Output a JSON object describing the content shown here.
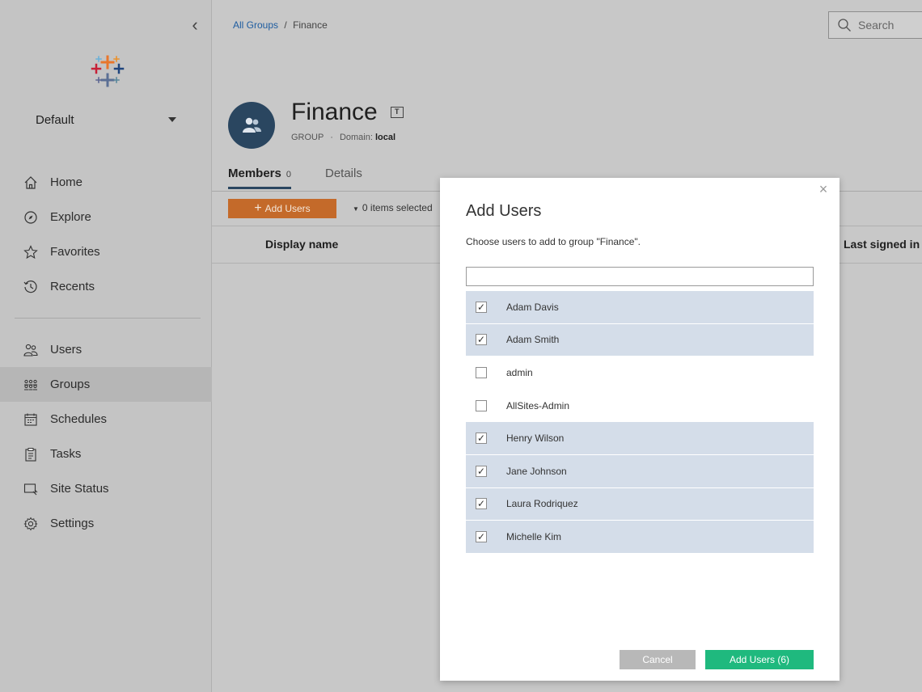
{
  "sidebar": {
    "site": "Default",
    "items": [
      {
        "label": "Home",
        "icon": "home-icon"
      },
      {
        "label": "Explore",
        "icon": "explore-icon"
      },
      {
        "label": "Favorites",
        "icon": "star-icon"
      },
      {
        "label": "Recents",
        "icon": "clock-icon"
      },
      {
        "label": "Users",
        "icon": "users-icon"
      },
      {
        "label": "Groups",
        "icon": "groups-icon",
        "active": true
      },
      {
        "label": "Schedules",
        "icon": "calendar-icon"
      },
      {
        "label": "Tasks",
        "icon": "clipboard-icon"
      },
      {
        "label": "Site Status",
        "icon": "monitor-icon"
      },
      {
        "label": "Settings",
        "icon": "gear-icon"
      }
    ]
  },
  "header": {
    "breadcrumb_root": "All Groups",
    "breadcrumb_sep": "/",
    "breadcrumb_current": "Finance",
    "search_placeholder": "Search"
  },
  "group": {
    "name": "Finance",
    "type": "GROUP",
    "separator": "·",
    "domain_label": "Domain:",
    "domain_value": "local",
    "badge": "T"
  },
  "tabs": [
    {
      "label": "Members",
      "count": "0"
    },
    {
      "label": "Details"
    }
  ],
  "toolbar": {
    "add_users": "Add Users",
    "selected": "0 items selected"
  },
  "table": {
    "col_display": "Display name",
    "col_last": "Last signed in"
  },
  "modal": {
    "title": "Add Users",
    "description": "Choose users to add to group \"Finance\".",
    "close": "×",
    "users": [
      {
        "name": "Adam Davis",
        "checked": true
      },
      {
        "name": "Adam Smith",
        "checked": true
      },
      {
        "name": "admin",
        "checked": false
      },
      {
        "name": "AllSites-Admin",
        "checked": false
      },
      {
        "name": "Henry Wilson",
        "checked": true
      },
      {
        "name": "Jane Johnson",
        "checked": true
      },
      {
        "name": "Laura Rodriquez",
        "checked": true
      },
      {
        "name": "Michelle Kim",
        "checked": true
      }
    ],
    "cancel": "Cancel",
    "confirm": "Add Users (6)"
  },
  "colors": {
    "accent_orange": "#c46a2a",
    "confirm_green": "#1fb97e",
    "avatar_navy": "#2a4660",
    "selected_row": "#d4dde9"
  }
}
